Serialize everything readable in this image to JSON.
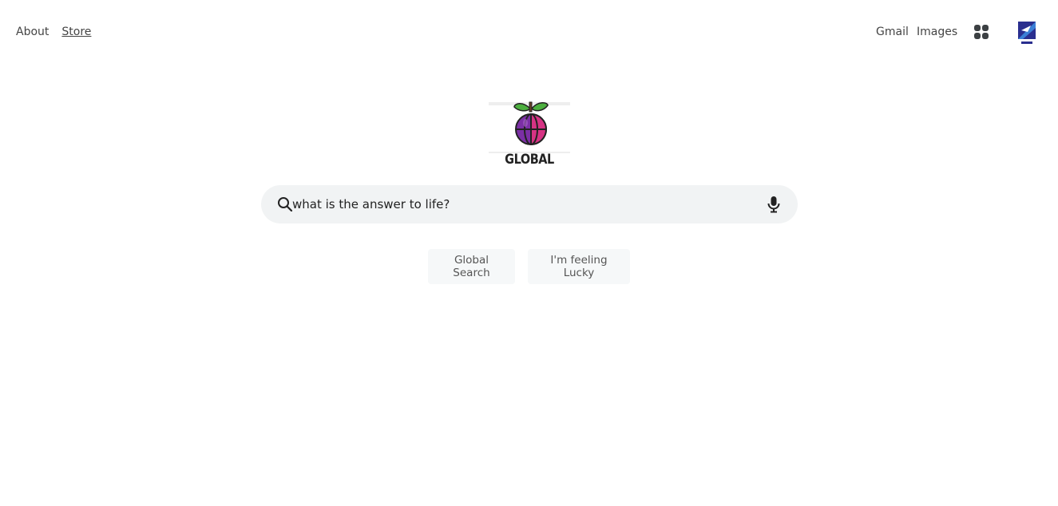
{
  "nav_left": {
    "about": "About",
    "store": "Store"
  },
  "nav_right": {
    "gmail": "Gmail",
    "images": "Images",
    "apps_icon": "apps-grid-icon"
  },
  "logo": {
    "text": "GLOBAL"
  },
  "search": {
    "value": "what is the answer to life?",
    "search_icon": "search-icon",
    "mic_icon": "microphone-icon"
  },
  "buttons": {
    "search": "Global Search",
    "lucky": "I'm feeling Lucky"
  },
  "colors": {
    "search_bg": "#f1f3f4",
    "button_bg": "#f6f8f9",
    "fruit_purple": "#7b2fa5",
    "fruit_pink": "#d63384",
    "leaf_green": "#4caf3f"
  }
}
